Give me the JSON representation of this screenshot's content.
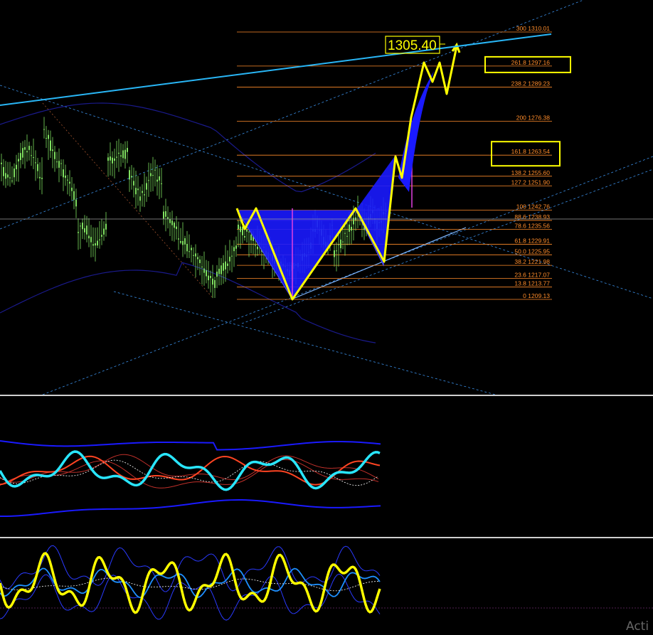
{
  "chart_data": {
    "type": "line",
    "title": "",
    "price_label": "1305.40",
    "fibonacci_levels": [
      {
        "ratio": "300",
        "price": "1310.01"
      },
      {
        "ratio": "261.8",
        "price": "1297.16",
        "boxed": true
      },
      {
        "ratio": "238.2",
        "price": "1289.23"
      },
      {
        "ratio": "200",
        "price": "1276.38"
      },
      {
        "ratio": "161.8",
        "price": "1263.54",
        "boxed": true
      },
      {
        "ratio": "138.2",
        "price": "1255.60"
      },
      {
        "ratio": "127.2",
        "price": "1251.90"
      },
      {
        "ratio": "100",
        "price": "1242.76"
      },
      {
        "ratio": "88.6",
        "price": "1238.93"
      },
      {
        "ratio": "78.6",
        "price": "1235.56"
      },
      {
        "ratio": "61.8",
        "price": "1229.91"
      },
      {
        "ratio": "50.0",
        "price": "1225.95"
      },
      {
        "ratio": "38.2",
        "price": "1221.98"
      },
      {
        "ratio": "23.6",
        "price": "1217.07"
      },
      {
        "ratio": "13.8",
        "price": "1213.77"
      },
      {
        "ratio": "0",
        "price": "1209.13"
      }
    ],
    "harmonic_pattern_prices": [
      1242.76,
      1209.13,
      1242.76,
      1222.0,
      1263.5
    ],
    "projection_path_prices": [
      1222.0,
      1263.5,
      1255.6,
      1297.2,
      1289.2,
      1297.2,
      1289.2,
      1305.4
    ],
    "oscillators": [
      "panel-2",
      "panel-3"
    ]
  },
  "colors": {
    "background": "#000000",
    "candles": "#7fe060",
    "fib_lines": "#ff8c2a",
    "pattern_fill": "#1a1aff",
    "pattern_lines": "#ffff00",
    "trendline": "#29b6f6",
    "channel_lines": "#3a8ee6",
    "indicator_cyan": "#29e6ff",
    "indicator_red": "#ff4422"
  },
  "watermark": "Acti"
}
